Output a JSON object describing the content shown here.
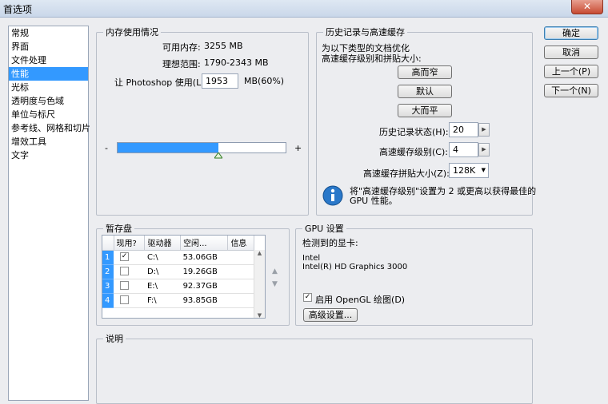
{
  "window": {
    "title": "首选项",
    "close_glyph": "✕"
  },
  "sidebar": {
    "items": [
      {
        "label": "常规"
      },
      {
        "label": "界面"
      },
      {
        "label": "文件处理"
      },
      {
        "label": "性能"
      },
      {
        "label": "光标"
      },
      {
        "label": "透明度与色域"
      },
      {
        "label": "单位与标尺"
      },
      {
        "label": "参考线、网格和切片"
      },
      {
        "label": "增效工具"
      },
      {
        "label": "文字"
      }
    ],
    "selected": "性能"
  },
  "memory": {
    "legend": "内存使用情况",
    "available_label": "可用内存:",
    "available_value": "3255 MB",
    "ideal_label": "理想范围:",
    "ideal_value": "1790-2343 MB",
    "let_label": "让 Photoshop 使用(L):",
    "let_value": "1953",
    "let_unit": "MB(60%)",
    "minus": "-",
    "plus": "+",
    "slider_fraction": 0.6
  },
  "history": {
    "legend": "历史记录与高速缓存",
    "desc_line1": "为以下类型的文档优化",
    "desc_line2": "高速缓存级别和拼贴大小:",
    "btn_tall": "高而窄",
    "btn_default": "默认",
    "btn_wide": "大而平",
    "states_label": "历史记录状态(H):",
    "states_value": "20",
    "levels_label": "高速缓存级别(C):",
    "levels_value": "4",
    "tile_label": "高速缓存拼贴大小(Z):",
    "tile_value": "128K",
    "info_line1": "将\"高速缓存级别\"设置为 2 或更高以获得最佳的",
    "info_line2": "GPU 性能。"
  },
  "scratch": {
    "legend": "暂存盘",
    "headers": {
      "active": "现用?",
      "drive": "驱动器",
      "free": "空闲...",
      "info": "信息"
    },
    "rows": [
      {
        "num": "1",
        "checked": "✓",
        "drive": "C:\\",
        "free": "53.06GB",
        "info": ""
      },
      {
        "num": "2",
        "checked": "",
        "drive": "D:\\",
        "free": "19.26GB",
        "info": ""
      },
      {
        "num": "3",
        "checked": "",
        "drive": "E:\\",
        "free": "92.37GB",
        "info": ""
      },
      {
        "num": "4",
        "checked": "",
        "drive": "F:\\",
        "free": "93.85GB",
        "info": ""
      }
    ]
  },
  "gpu": {
    "legend": "GPU 设置",
    "detected_label": "检测到的显卡:",
    "vendor": "Intel",
    "model": "Intel(R) HD Graphics 3000",
    "opengl_label": "启用 OpenGL 绘图(D)",
    "opengl_checked": "✓",
    "advanced_button": "高级设置..."
  },
  "description": {
    "legend": "说明"
  },
  "buttons": {
    "ok": "确定",
    "cancel": "取消",
    "prev": "上一个(P)",
    "next": "下一个(N)"
  },
  "colors": {
    "selection": "#3399ff",
    "slider_fill": "#3399ff"
  }
}
